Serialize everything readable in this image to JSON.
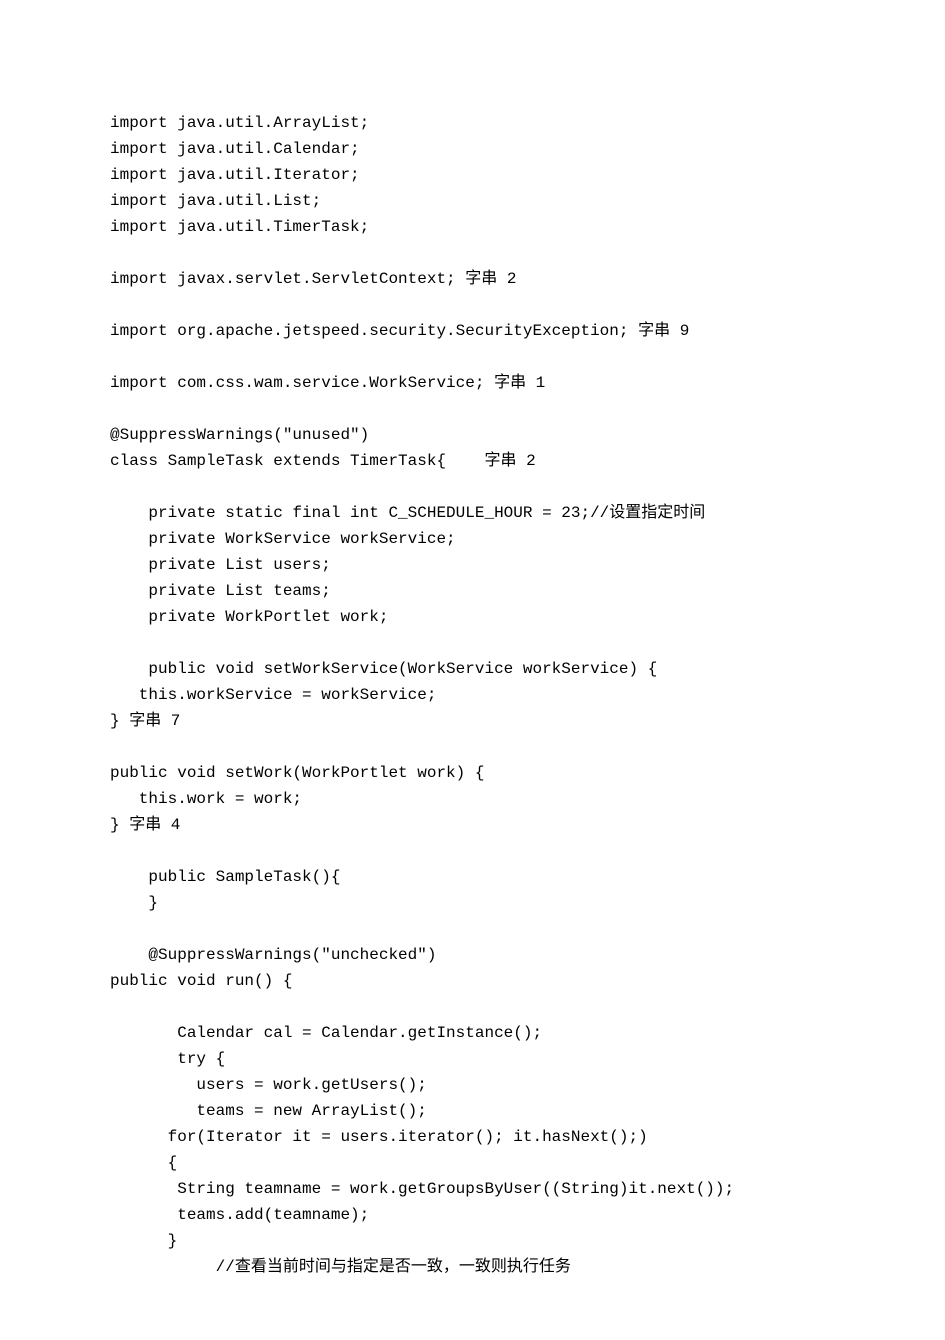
{
  "code": {
    "lines": [
      "import java.util.ArrayList;",
      "import java.util.Calendar;",
      "import java.util.Iterator;",
      "import java.util.List;",
      "import java.util.TimerTask;",
      "",
      "import javax.servlet.ServletContext; 字串 2",
      "",
      "import org.apache.jetspeed.security.SecurityException; 字串 9",
      "",
      "import com.css.wam.service.WorkService; 字串 1",
      "",
      "@SuppressWarnings(\"unused\")",
      "class SampleTask extends TimerTask{    字串 2",
      "",
      "    private static final int C_SCHEDULE_HOUR = 23;//设置指定时间",
      "    private WorkService workService;",
      "    private List users;",
      "    private List teams;",
      "    private WorkPortlet work;",
      "",
      "    public void setWorkService(WorkService workService) {",
      "   this.workService = workService;",
      "} 字串 7",
      "",
      "public void setWork(WorkPortlet work) {",
      "   this.work = work;",
      "} 字串 4",
      "",
      "    public SampleTask(){",
      "    }",
      "",
      "    @SuppressWarnings(\"unchecked\")",
      "public void run() {",
      "",
      "       Calendar cal = Calendar.getInstance();",
      "       try {",
      "         users = work.getUsers();",
      "         teams = new ArrayList();",
      "      for(Iterator it = users.iterator(); it.hasNext();)",
      "      {",
      "       String teamname = work.getGroupsByUser((String)it.next());",
      "       teams.add(teamname);",
      "      }",
      "           //查看当前时间与指定是否一致，一致则执行任务"
    ]
  }
}
